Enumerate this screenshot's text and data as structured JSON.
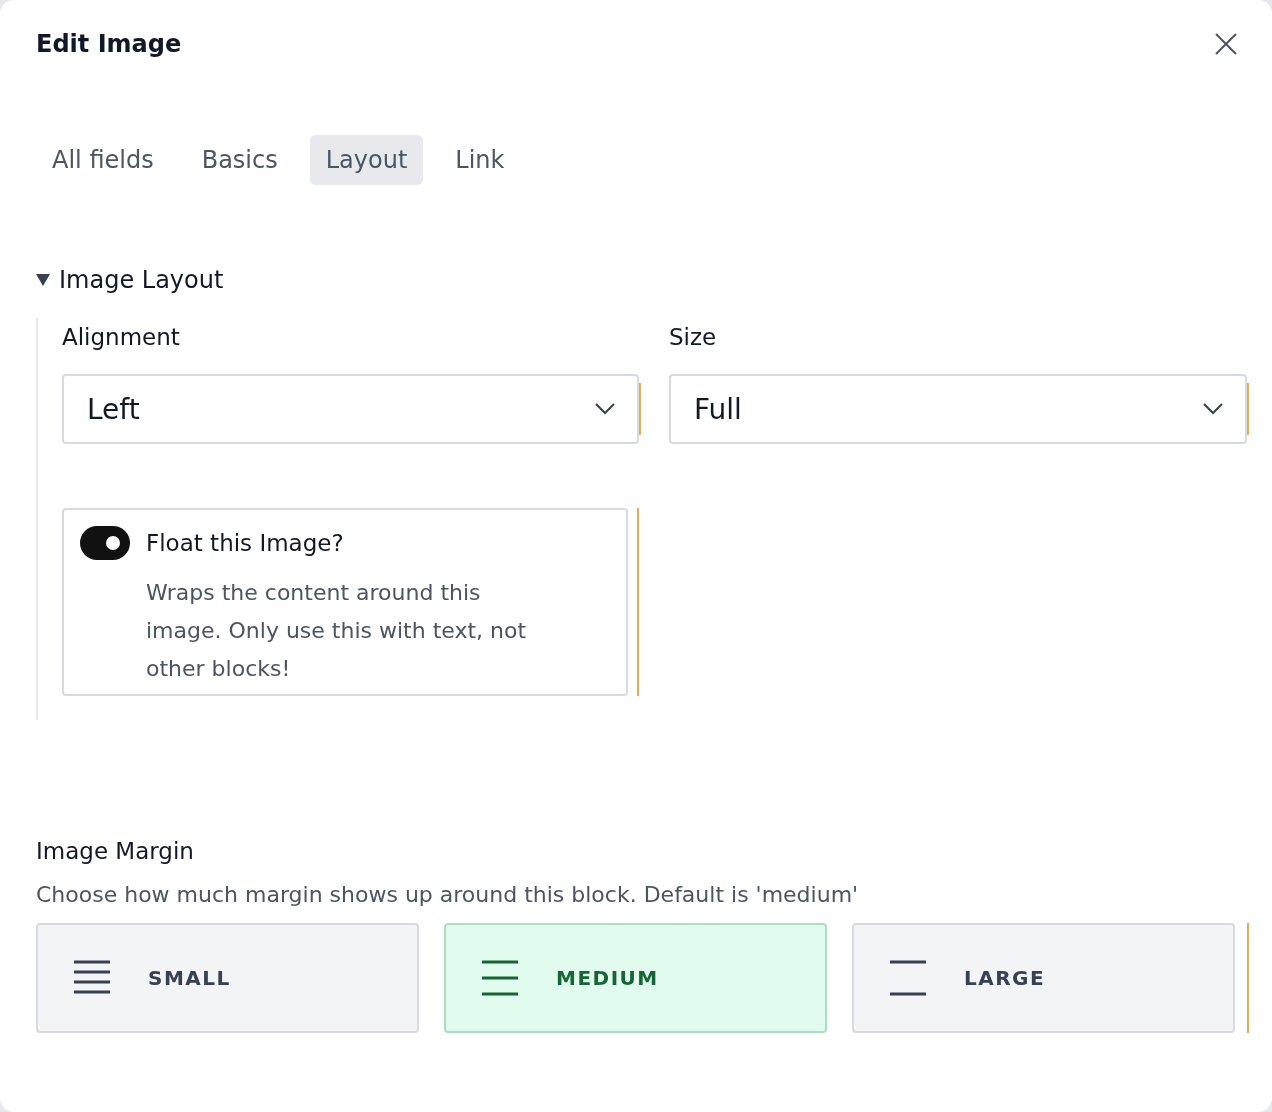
{
  "dialog": {
    "title": "Edit Image"
  },
  "tabs": [
    {
      "label": "All fields",
      "selected": false
    },
    {
      "label": "Basics",
      "selected": false
    },
    {
      "label": "Layout",
      "selected": true
    },
    {
      "label": "Link",
      "selected": false
    }
  ],
  "section": {
    "title": "Image Layout",
    "expanded": true,
    "selects": [
      {
        "label": "Alignment",
        "value": "Left"
      },
      {
        "label": "Size",
        "value": "Full"
      }
    ],
    "toggle": {
      "label": "Float this Image?",
      "on": true,
      "help": "Wraps the content around this image. Only use this with text, not other blocks!"
    }
  },
  "margin": {
    "label": "Image Margin",
    "help": "Choose how much margin shows up around this block. Default is 'medium'",
    "options": [
      {
        "kind": "small",
        "label": "SMALL",
        "selected": false
      },
      {
        "kind": "medium",
        "label": "MEDIUM",
        "selected": true
      },
      {
        "kind": "large",
        "label": "LARGE",
        "selected": false
      }
    ]
  }
}
